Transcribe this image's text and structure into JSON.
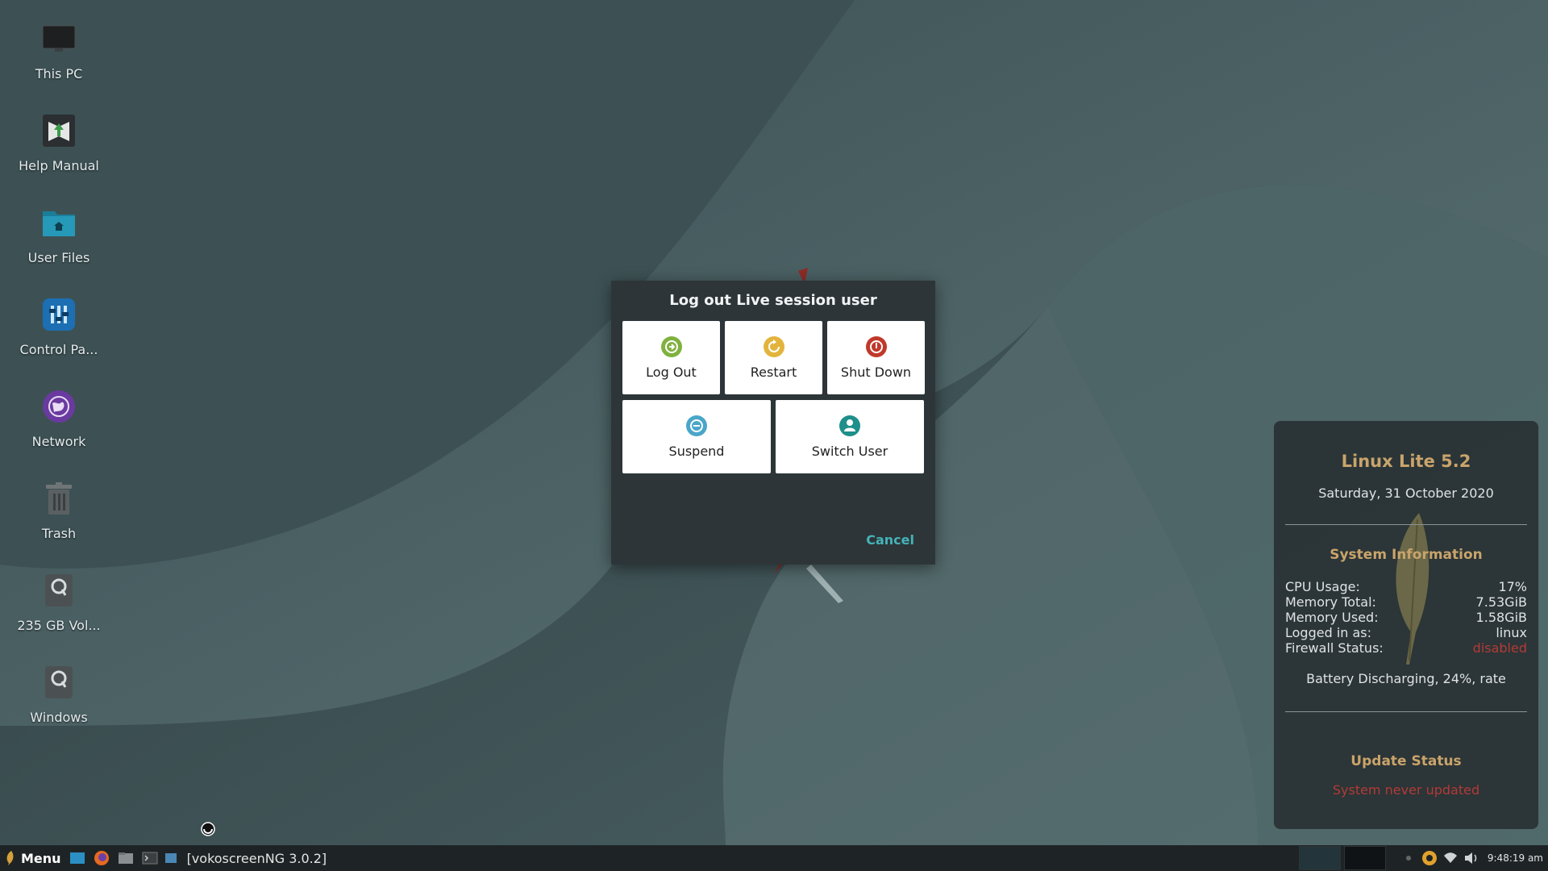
{
  "desktop": {
    "icons": [
      {
        "label": "This PC",
        "icon": "monitor-icon"
      },
      {
        "label": "Help Manual",
        "icon": "help-manual-icon"
      },
      {
        "label": "User Files",
        "icon": "home-folder-icon"
      },
      {
        "label": "Control Pa...",
        "icon": "control-panel-icon"
      },
      {
        "label": "Network",
        "icon": "network-globe-icon"
      },
      {
        "label": "Trash",
        "icon": "trash-icon"
      },
      {
        "label": "235 GB Vol...",
        "icon": "drive-icon"
      },
      {
        "label": "Windows",
        "icon": "drive-icon"
      }
    ]
  },
  "dialog": {
    "title": "Log out Live session user",
    "options": [
      {
        "label": "Log Out",
        "icon": "logout-icon",
        "color": "#7fb13f"
      },
      {
        "label": "Restart",
        "icon": "restart-icon",
        "color": "#e3b43c"
      },
      {
        "label": "Shut Down",
        "icon": "power-icon",
        "color": "#c0392b"
      },
      {
        "label": "Suspend",
        "icon": "suspend-icon",
        "color": "#4aa6c9"
      },
      {
        "label": "Switch User",
        "icon": "user-icon",
        "color": "#1e8f8a"
      }
    ],
    "cancel": "Cancel"
  },
  "conky": {
    "title": "Linux Lite 5.2",
    "date": "Saturday, 31 October 2020",
    "sysinfo_heading": "System Information",
    "rows": [
      {
        "label": "CPU Usage:",
        "value": "17%"
      },
      {
        "label": "Memory Total:",
        "value": "7.53GiB"
      },
      {
        "label": "Memory Used:",
        "value": "1.58GiB"
      },
      {
        "label": "Logged in as:",
        "value": "linux"
      },
      {
        "label": "Firewall Status:",
        "value": "disabled"
      }
    ],
    "battery": "Battery Discharging, 24%, rate",
    "update_heading": "Update Status",
    "update_status": "System never updated"
  },
  "taskbar": {
    "menu_label": "Menu",
    "task_label": "[vokoscreenNG 3.0.2]",
    "clock": "9:48:19 am"
  },
  "colors": {
    "accent": "#45b4b8",
    "heading": "#c9a46b",
    "alert": "#b23b36"
  }
}
